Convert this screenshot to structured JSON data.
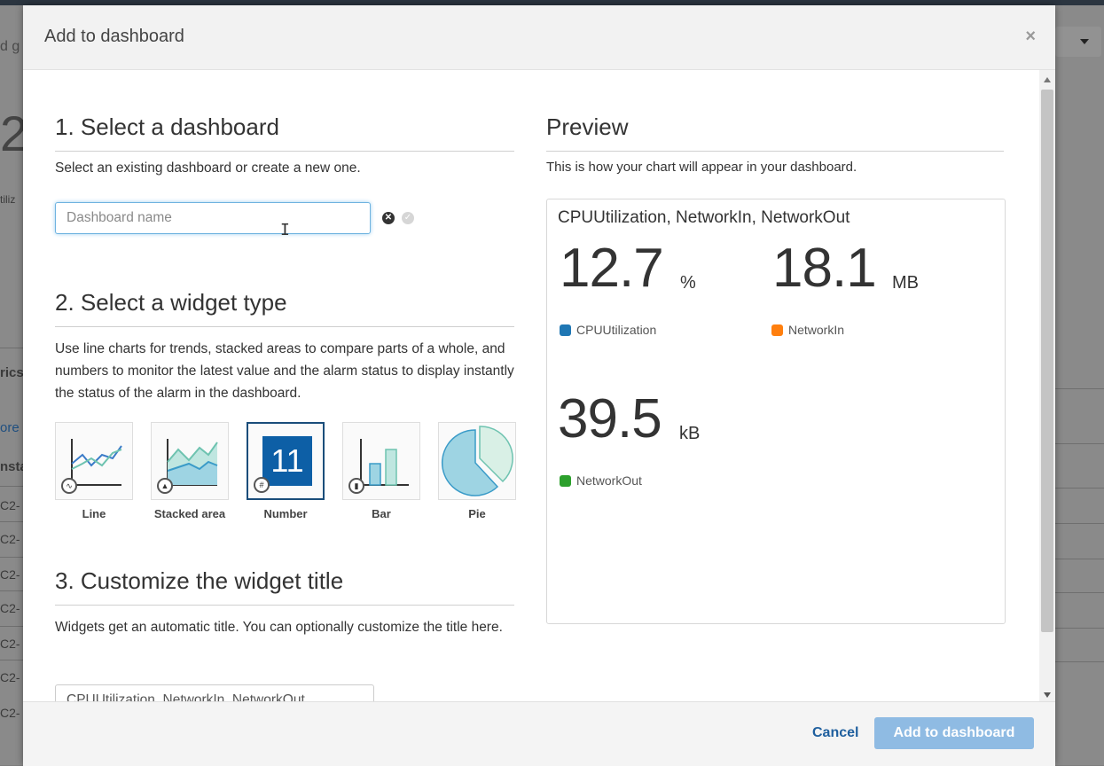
{
  "background": {
    "fragments": [
      "d g",
      "2",
      "tiliz",
      "rics",
      "ore",
      "nsta",
      "C2-",
      "C2-",
      "C2-",
      "C2-",
      "C2-",
      "C2-",
      "C2-"
    ]
  },
  "modal": {
    "title": "Add to dashboard",
    "close_symbol": "×"
  },
  "step1": {
    "heading": "1. Select a dashboard",
    "description": "Select an existing dashboard or create a new one.",
    "input_placeholder": "Dashboard name",
    "clear_symbol": "✕",
    "check_symbol": "✓"
  },
  "step2": {
    "heading": "2. Select a widget type",
    "description": "Use line charts for trends, stacked areas to compare parts of a whole, and numbers to monitor the latest value and the alarm status to display instantly the status of the alarm in the dashboard.",
    "widgets": [
      {
        "label": "Line",
        "icon": "line-chart-icon",
        "selected": false
      },
      {
        "label": "Stacked area",
        "icon": "stacked-area-icon",
        "selected": false
      },
      {
        "label": "Number",
        "icon": "number-icon",
        "selected": true,
        "icon_text": "11",
        "badge_text": "#"
      },
      {
        "label": "Bar",
        "icon": "bar-chart-icon",
        "selected": false
      },
      {
        "label": "Pie",
        "icon": "pie-chart-icon",
        "selected": false
      }
    ]
  },
  "step3": {
    "heading": "3. Customize the widget title",
    "description": "Widgets get an automatic title. You can optionally customize the title here.",
    "title_value": "CPUUtilization, NetworkIn, NetworkOut"
  },
  "preview": {
    "heading": "Preview",
    "description": "This is how your chart will appear in your dashboard.",
    "chart_title": "CPUUtilization, NetworkIn, NetworkOut",
    "metrics": [
      {
        "value": "12.7",
        "unit": "%",
        "label": "CPUUtilization",
        "color": "#1f77b4"
      },
      {
        "value": "18.1",
        "unit": "MB",
        "label": "NetworkIn",
        "color": "#ff7f0e"
      },
      {
        "value": "39.5",
        "unit": "kB",
        "label": "NetworkOut",
        "color": "#2ca02c"
      }
    ]
  },
  "footer": {
    "cancel_label": "Cancel",
    "submit_label": "Add to dashboard"
  },
  "colors": {
    "accent": "#1f5f9e",
    "primary_button": "#8fbbe3",
    "selected_widget_border": "#1a4d7a",
    "number_tile": "#0d5fa6"
  }
}
